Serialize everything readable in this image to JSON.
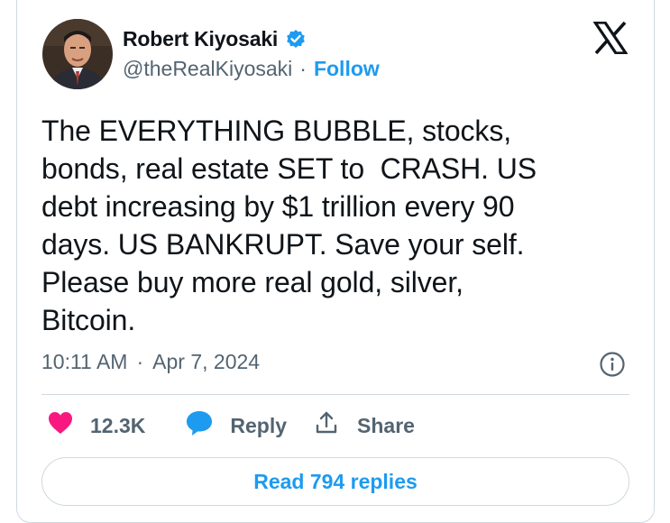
{
  "author": {
    "display_name": "Robert Kiyosaki",
    "handle": "@theRealKiyosaki",
    "separator": "·",
    "follow_label": "Follow",
    "verified": true
  },
  "tweet": {
    "text": "The EVERYTHING BUBBLE, stocks,\nbonds, real estate SET to  CRASH. US\ndebt increasing by $1 trillion every 90\ndays. US BANKRUPT. Save your self.\nPlease buy more real gold, silver,\nBitcoin.",
    "time": "10:11 AM",
    "date": "Apr 7, 2024",
    "separator": "·"
  },
  "actions": {
    "like_count": "12.3K",
    "reply_label": "Reply",
    "share_label": "Share"
  },
  "read_replies_label": "Read 794 replies",
  "icons": {
    "logo": "x-logo-icon",
    "verified": "verified-badge-icon",
    "info": "info-icon",
    "like": "heart-icon",
    "reply": "speech-bubble-icon",
    "share": "share-upload-icon"
  },
  "colors": {
    "accent": "#1d9bf0",
    "like": "#f91880",
    "text": "#0f1419",
    "secondary": "#536471",
    "border": "#cfd9de"
  }
}
